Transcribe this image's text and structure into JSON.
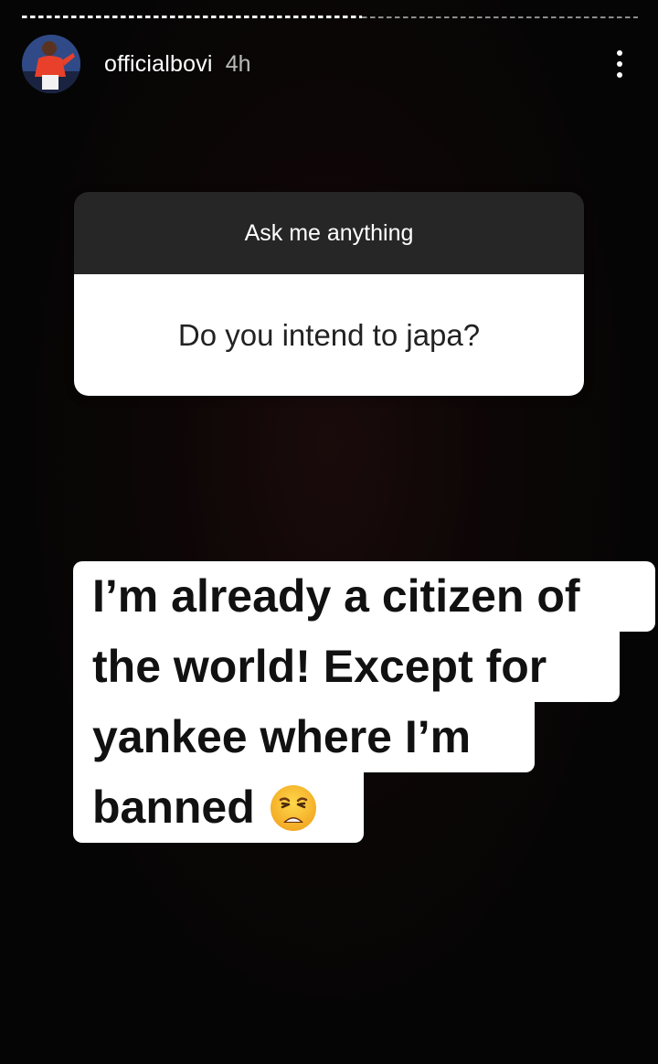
{
  "story": {
    "username": "officialbovi",
    "timestamp": "4h",
    "progress_segments": [
      {
        "state": "viewed"
      },
      {
        "state": "upcoming"
      }
    ]
  },
  "question_sticker": {
    "prompt": "Ask me anything",
    "question": "Do you intend to japa?"
  },
  "answer": {
    "lines": [
      "I’m already a citizen of",
      "the world! Except for",
      "yankee where I’m",
      "banned"
    ],
    "emoji_icon": "weary-face-emoji"
  },
  "icons": {
    "more": "more-vertical-icon",
    "avatar": "profile-avatar"
  },
  "colors": {
    "background": "#050505",
    "sticker_header": "#262626",
    "sticker_body": "#ffffff",
    "text_highlight": "#ffffff"
  }
}
